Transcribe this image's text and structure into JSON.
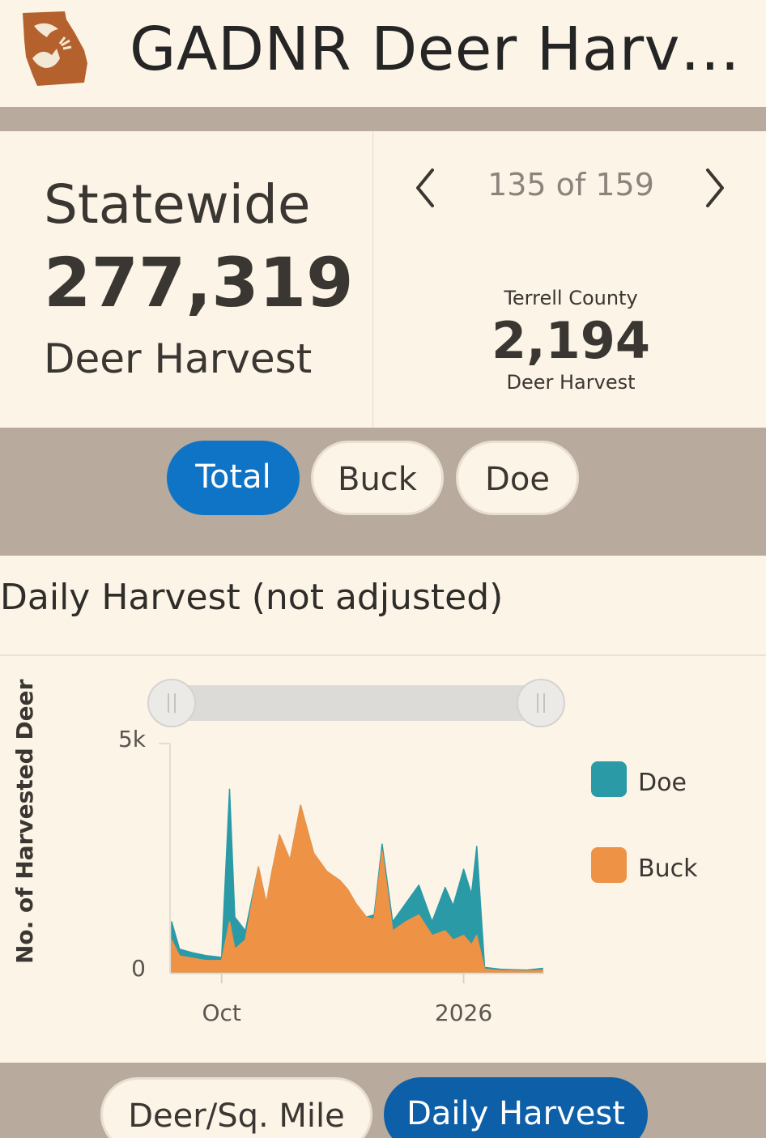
{
  "app": {
    "title": "GADNR Deer Harv…",
    "logo_icon": "georgia-state-deer-logo"
  },
  "statewide": {
    "label": "Statewide",
    "value": "277,319",
    "sublabel": "Deer Harvest"
  },
  "pager": {
    "prev_icon": "chevron-left-icon",
    "next_icon": "chevron-right-icon",
    "text": "135 of 159"
  },
  "county": {
    "name": "Terrell County",
    "value": "2,194",
    "sublabel": "Deer Harvest"
  },
  "filters": {
    "total": "Total",
    "buck": "Buck",
    "doe": "Doe",
    "active": "Total"
  },
  "section": {
    "title": "Daily Harvest (not adjusted)"
  },
  "views": {
    "density": "Deer/Sq. Mile",
    "daily": "Daily Harvest",
    "active": "Daily Harvest"
  },
  "colors": {
    "accent": "#0f74c6",
    "doe": "#2a9aa6",
    "buck": "#ee9246",
    "band": "#b8ab9d",
    "background": "#fcf4e6"
  },
  "chart_data": {
    "type": "area",
    "title": "",
    "xlabel": "",
    "ylabel": "No. of Harvested Deer",
    "ylim": [
      0,
      5000
    ],
    "y_ticks": [
      {
        "label": "0",
        "value": 0
      },
      {
        "label": "5k",
        "value": 5000
      }
    ],
    "x_range": [
      "2025-09-12",
      "2026-01-31"
    ],
    "x_ticks": [
      {
        "label": "Oct",
        "date": "2025-10-01"
      },
      {
        "label": "2026",
        "date": "2026-01-01"
      }
    ],
    "stacked": true,
    "legend": "right",
    "has_range_slider": true,
    "series": [
      {
        "name": "Doe",
        "color": "#2a9aa6",
        "points": [
          [
            "2025-09-12",
            1100
          ],
          [
            "2025-09-15",
            500
          ],
          [
            "2025-09-20",
            420
          ],
          [
            "2025-09-25",
            360
          ],
          [
            "2025-10-01",
            320
          ],
          [
            "2025-10-04",
            4000
          ],
          [
            "2025-10-06",
            1200
          ],
          [
            "2025-10-10",
            900
          ],
          [
            "2025-10-15",
            2300
          ],
          [
            "2025-10-18",
            1500
          ],
          [
            "2025-10-20",
            2150
          ],
          [
            "2025-10-23",
            3000
          ],
          [
            "2025-10-27",
            2450
          ],
          [
            "2025-10-31",
            3650
          ],
          [
            "2025-11-05",
            2600
          ],
          [
            "2025-11-10",
            2200
          ],
          [
            "2025-11-15",
            2000
          ],
          [
            "2025-11-18",
            1800
          ],
          [
            "2025-11-21",
            1500
          ],
          [
            "2025-11-25",
            1200
          ],
          [
            "2025-11-28",
            1250
          ],
          [
            "2025-12-01",
            2800
          ],
          [
            "2025-12-05",
            1100
          ],
          [
            "2025-12-10",
            1500
          ],
          [
            "2025-12-15",
            1900
          ],
          [
            "2025-12-20",
            1100
          ],
          [
            "2025-12-25",
            1850
          ],
          [
            "2025-12-28",
            1450
          ],
          [
            "2026-01-01",
            2250
          ],
          [
            "2026-01-04",
            1700
          ],
          [
            "2026-01-06",
            2750
          ],
          [
            "2026-01-09",
            100
          ],
          [
            "2026-01-15",
            60
          ],
          [
            "2026-01-20",
            50
          ],
          [
            "2026-01-25",
            40
          ],
          [
            "2026-01-31",
            80
          ]
        ]
      },
      {
        "name": "Buck",
        "color": "#ee9246",
        "points": [
          [
            "2025-09-12",
            700
          ],
          [
            "2025-09-15",
            350
          ],
          [
            "2025-09-20",
            300
          ],
          [
            "2025-09-25",
            250
          ],
          [
            "2025-10-01",
            250
          ],
          [
            "2025-10-04",
            1100
          ],
          [
            "2025-10-06",
            500
          ],
          [
            "2025-10-10",
            700
          ],
          [
            "2025-10-15",
            2300
          ],
          [
            "2025-10-18",
            1500
          ],
          [
            "2025-10-20",
            2150
          ],
          [
            "2025-10-23",
            3000
          ],
          [
            "2025-10-27",
            2450
          ],
          [
            "2025-10-31",
            3650
          ],
          [
            "2025-11-05",
            2600
          ],
          [
            "2025-11-10",
            2200
          ],
          [
            "2025-11-15",
            2000
          ],
          [
            "2025-11-18",
            1800
          ],
          [
            "2025-11-21",
            1500
          ],
          [
            "2025-11-25",
            1200
          ],
          [
            "2025-11-28",
            1150
          ],
          [
            "2025-12-01",
            2650
          ],
          [
            "2025-12-05",
            900
          ],
          [
            "2025-12-10",
            1100
          ],
          [
            "2025-12-15",
            1250
          ],
          [
            "2025-12-20",
            800
          ],
          [
            "2025-12-25",
            900
          ],
          [
            "2025-12-28",
            700
          ],
          [
            "2026-01-01",
            800
          ],
          [
            "2026-01-04",
            600
          ],
          [
            "2026-01-06",
            800
          ],
          [
            "2026-01-09",
            60
          ],
          [
            "2026-01-15",
            30
          ],
          [
            "2026-01-20",
            30
          ],
          [
            "2026-01-25",
            20
          ],
          [
            "2026-01-31",
            40
          ]
        ]
      }
    ]
  }
}
